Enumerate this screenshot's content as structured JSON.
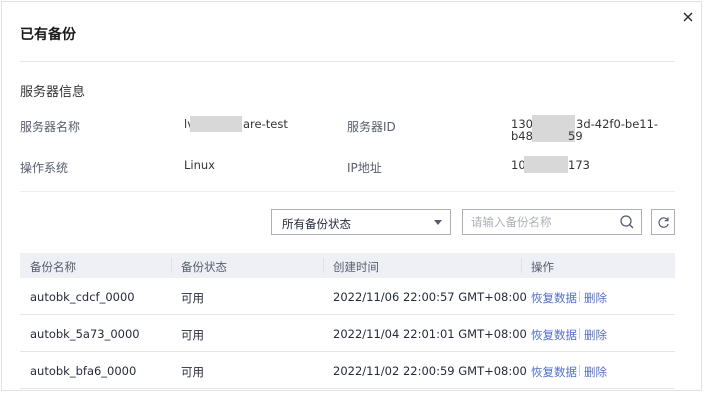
{
  "dialog": {
    "title": "已有备份",
    "close_icon": "close-icon"
  },
  "server_info": {
    "section_title": "服务器信息",
    "name_label": "服务器名称",
    "name_value_prefix": "lv",
    "name_value_suffix": "are-test",
    "id_label": "服务器ID",
    "id_value_line1_prefix": "130",
    "id_value_line1_suffix": "3d-42f0-be11-",
    "id_value_line2_prefix": "b48",
    "id_value_line2_suffix": "59",
    "os_label": "操作系统",
    "os_value": "Linux",
    "ip_label": "IP地址",
    "ip_value_prefix": "10",
    "ip_value_suffix": "173"
  },
  "toolbar": {
    "status_select_value": "所有备份状态",
    "search_placeholder": "请输入备份名称",
    "search_icon": "search-icon",
    "refresh_icon": "refresh-icon"
  },
  "table": {
    "headers": [
      "备份名称",
      "备份状态",
      "创建时间",
      "操作"
    ],
    "rows": [
      {
        "name": "autobk_cdcf_0000",
        "status": "可用",
        "created": "2022/11/06 22:00:57 GMT+08:00",
        "restore": "恢复数据",
        "delete": "删除"
      },
      {
        "name": "autobk_5a73_0000",
        "status": "可用",
        "created": "2022/11/04 22:01:01 GMT+08:00",
        "restore": "恢复数据",
        "delete": "删除"
      },
      {
        "name": "autobk_bfa6_0000",
        "status": "可用",
        "created": "2022/11/02 22:00:59 GMT+08:00",
        "restore": "恢复数据",
        "delete": "删除"
      }
    ]
  },
  "colors": {
    "link": "#526ecc",
    "header_bg": "#eef0f5"
  }
}
